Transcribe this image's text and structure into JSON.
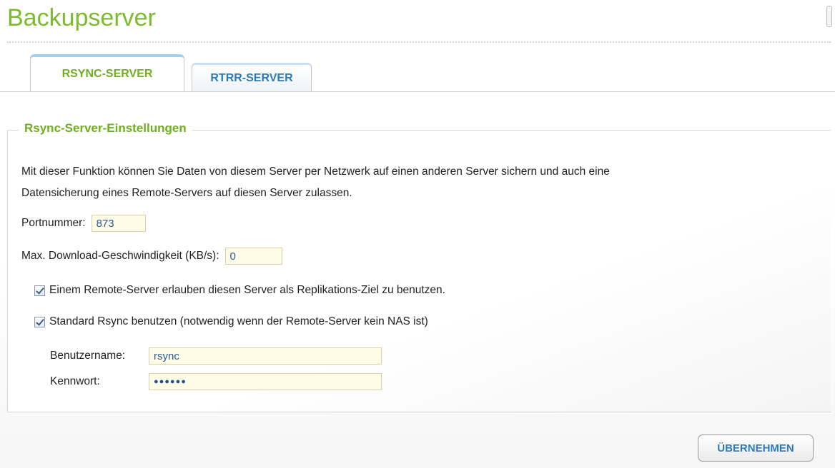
{
  "page": {
    "title": "Backupserver"
  },
  "tabs": [
    {
      "label": "RSYNC-SERVER",
      "active": true
    },
    {
      "label": "RTRR-SERVER",
      "active": false
    }
  ],
  "section": {
    "legend": "Rsync-Server-Einstellungen",
    "description_line1": "Mit dieser Funktion können Sie Daten von diesem Server per Netzwerk auf einen anderen Server sichern und auch eine",
    "description_line2": "Datensicherung eines Remote-Servers auf diesen Server zulassen."
  },
  "form": {
    "port_label": "Portnummer:",
    "port_value": "873",
    "max_download_label": "Max. Download-Geschwindigkeit (KB/s):",
    "max_download_value": "0",
    "allow_remote_label": "Einem Remote-Server erlauben diesen Server als Replikations-Ziel zu benutzen.",
    "allow_remote_checked": true,
    "standard_rsync_label": "Standard Rsync benutzen (notwendig wenn der Remote-Server kein NAS ist)",
    "standard_rsync_checked": true,
    "username_label": "Benutzername:",
    "username_value": "rsync",
    "password_label": "Kennwort:",
    "password_value": "●●●●●●"
  },
  "actions": {
    "apply_label": "ÜBERNEHMEN"
  },
  "colors": {
    "title_green": "#7cbb2d",
    "tab_active_green": "#6fae1f",
    "tab_inactive_blue": "#2e7ab8",
    "field_bg": "#fefbe6",
    "field_text": "#2a5a9a"
  }
}
